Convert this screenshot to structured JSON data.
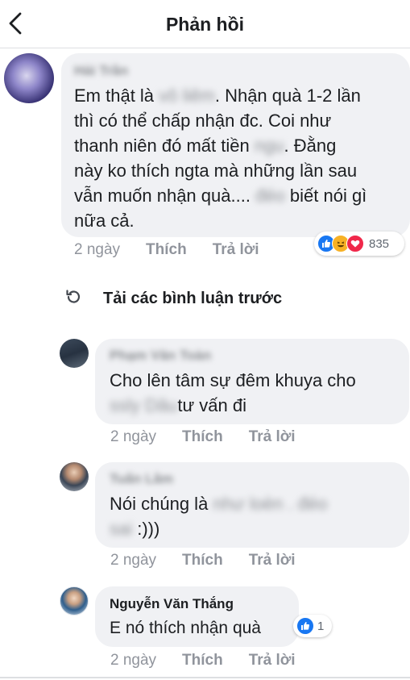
{
  "header": {
    "title": "Phản hồi",
    "back_icon": "chevron-left-icon"
  },
  "colors": {
    "bubble": "#f0f1f4",
    "like": "#1877f2",
    "love": "#f0284a",
    "haha": "#f7b125",
    "muted": "#90949c"
  },
  "comments": [
    {
      "author": "Hải Trần",
      "author_blurred": true,
      "text_lines": [
        [
          "Em thật là ",
          {
            "blur": "vô liêm"
          },
          ". Nhận quà 1-2 lần"
        ],
        [
          "thì có thể chấp nhận đc. Coi như"
        ],
        [
          "thanh niên đó mất tiền ",
          {
            "blur": "ngu"
          },
          ". Đằng"
        ],
        [
          "này ko thích ngta mà những lần sau"
        ],
        [
          "vẫn muốn nhận quà.... ",
          {
            "blur": "đéo"
          },
          " biết nói gì"
        ],
        [
          "nữa cả."
        ]
      ],
      "time": "2 ngày",
      "like_label": "Thích",
      "reply_label": "Trả lời",
      "reactions": {
        "types": [
          "like",
          "haha",
          "love"
        ],
        "count": "835"
      }
    },
    {
      "author": "Phạm Văn Toàn",
      "author_blurred": true,
      "text_lines": [
        [
          "Cho lên tâm sự đêm khuya cho"
        ],
        [
          {
            "blur": "ssly Dâu"
          },
          "tư vấn đi"
        ]
      ],
      "time": "2 ngày",
      "like_label": "Thích",
      "reply_label": "Trả lời"
    },
    {
      "author": "Tuấn Lâm",
      "author_blurred": true,
      "text_lines": [
        [
          "Nói chúng là ",
          {
            "blur": "như loèn . đéo"
          }
        ],
        [
          {
            "blur": "sai"
          },
          " :)))"
        ]
      ],
      "time": "2 ngày",
      "like_label": "Thích",
      "reply_label": "Trả lời"
    },
    {
      "author": "Nguyễn Văn Thắng",
      "author_blurred": false,
      "text_lines": [
        [
          "E nó thích nhận quà"
        ]
      ],
      "time": "2 ngày",
      "like_label": "Thích",
      "reply_label": "Trả lời",
      "reactions": {
        "types": [
          "like"
        ],
        "count": "1"
      }
    }
  ],
  "load_previous": {
    "label": "Tải các bình luận trước",
    "icon": "refresh-icon"
  }
}
